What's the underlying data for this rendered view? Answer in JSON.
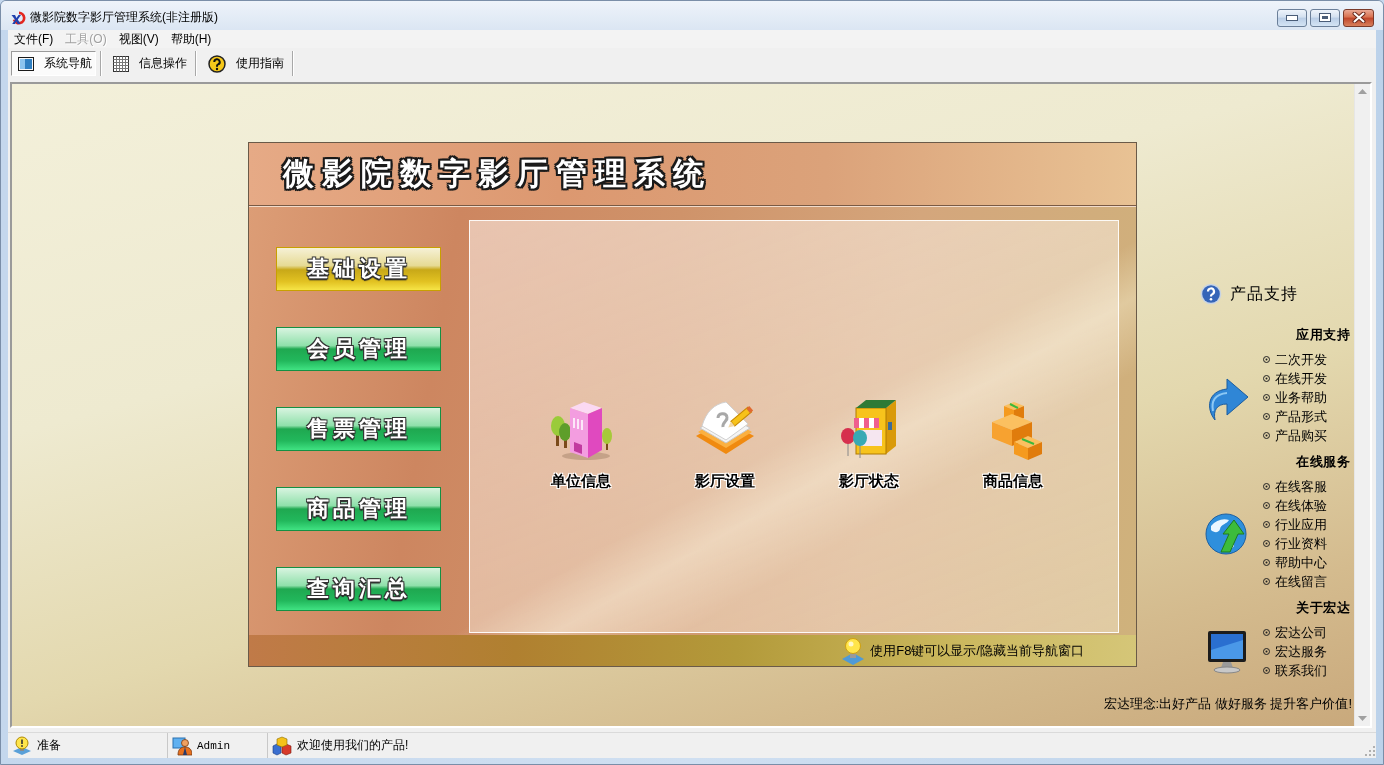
{
  "window": {
    "title": "微影院数字影厅管理系统(非注册版)"
  },
  "menu": [
    {
      "label": "文件(F)",
      "disabled": false
    },
    {
      "label": "工具(O)",
      "disabled": true
    },
    {
      "label": "视图(V)",
      "disabled": false
    },
    {
      "label": "帮助(H)",
      "disabled": false
    }
  ],
  "toolbar": [
    {
      "label": "系统导航",
      "kind": "monitor",
      "selected": true
    },
    {
      "label": "信息操作",
      "kind": "grid",
      "selected": false
    },
    {
      "label": "使用指南",
      "kind": "help",
      "selected": false
    }
  ],
  "panel": {
    "title": "微影院数字影厅管理系统",
    "nav": [
      {
        "label": "基础设置",
        "selected": true
      },
      {
        "label": "会员管理",
        "selected": false
      },
      {
        "label": "售票管理",
        "selected": false
      },
      {
        "label": "商品管理",
        "selected": false
      },
      {
        "label": "查询汇总",
        "selected": false
      }
    ],
    "modules": [
      {
        "label": "单位信息",
        "kind": "building"
      },
      {
        "label": "影厅设置",
        "kind": "book"
      },
      {
        "label": "影厅状态",
        "kind": "booth"
      },
      {
        "label": "商品信息",
        "kind": "boxes"
      }
    ],
    "hint": "使用F8键可以显示/隐藏当前导航窗口"
  },
  "support": {
    "title": "产品支持",
    "sections": [
      {
        "heading": "应用支持",
        "kind": "arrow",
        "links": [
          "二次开发",
          "在线开发",
          "业务帮助",
          "产品形式",
          "产品购买"
        ]
      },
      {
        "heading": "在线服务",
        "kind": "globe",
        "links": [
          "在线客服",
          "在线体验",
          "行业应用",
          "行业资料",
          "帮助中心",
          "在线留言"
        ]
      },
      {
        "heading": "关于宏达",
        "kind": "monitor",
        "links": [
          "宏达公司",
          "宏达服务",
          "联系我们"
        ]
      }
    ],
    "motto": "宏达理念:出好产品 做好服务 提升客户价值!"
  },
  "status_bar": [
    {
      "kind": "bulb",
      "text": "准备"
    },
    {
      "kind": "user",
      "text": "Admin"
    },
    {
      "kind": "cubes",
      "text": "欢迎使用我们的产品!"
    }
  ]
}
